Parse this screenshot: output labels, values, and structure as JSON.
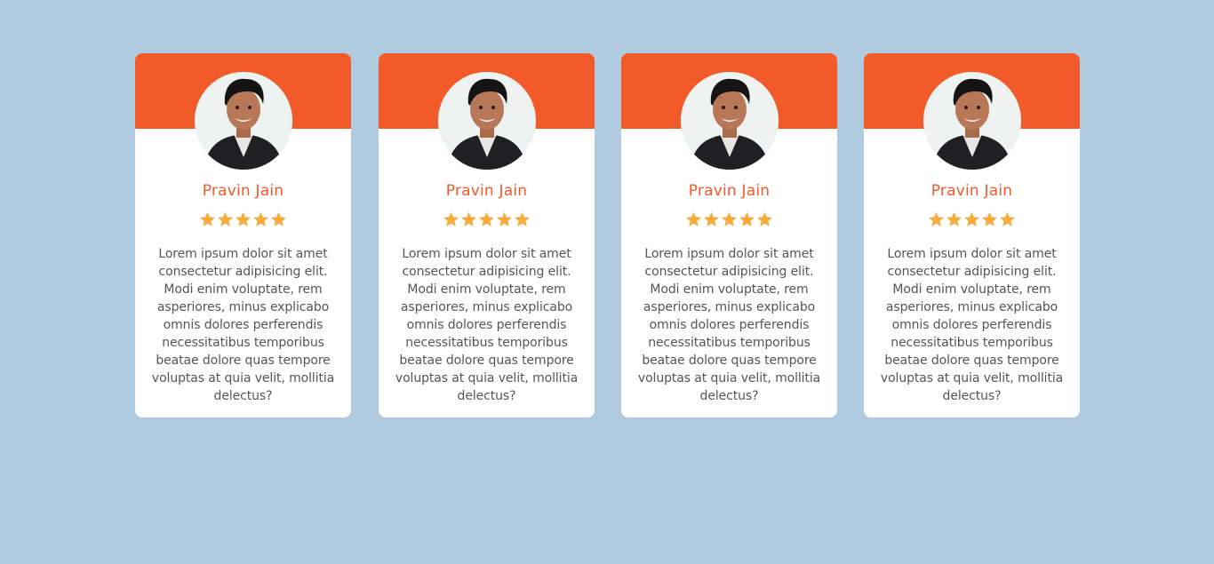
{
  "colors": {
    "page_background": "#b0cbdf",
    "card_background": "#ffffff",
    "accent": "#f25a29",
    "star": "#f6ac3c",
    "body_text": "#555555"
  },
  "cards": [
    {
      "avatar_icon": "user-photo",
      "name": "Pravin Jain",
      "rating": 5,
      "rating_max": 5,
      "review": "Lorem ipsum dolor sit amet consectetur adipisicing elit. Modi enim voluptate, rem asperiores, minus explicabo omnis dolores perferendis necessitatibus temporibus beatae dolore quas tempore voluptas at quia velit, mollitia delectus?"
    },
    {
      "avatar_icon": "user-photo",
      "name": "Pravin Jain",
      "rating": 5,
      "rating_max": 5,
      "review": "Lorem ipsum dolor sit amet consectetur adipisicing elit. Modi enim voluptate, rem asperiores, minus explicabo omnis dolores perferendis necessitatibus temporibus beatae dolore quas tempore voluptas at quia velit, mollitia delectus?"
    },
    {
      "avatar_icon": "user-photo",
      "name": "Pravin Jain",
      "rating": 5,
      "rating_max": 5,
      "review": "Lorem ipsum dolor sit amet consectetur adipisicing elit. Modi enim voluptate, rem asperiores, minus explicabo omnis dolores perferendis necessitatibus temporibus beatae dolore quas tempore voluptas at quia velit, mollitia delectus?"
    },
    {
      "avatar_icon": "user-photo",
      "name": "Pravin Jain",
      "rating": 5,
      "rating_max": 5,
      "review": "Lorem ipsum dolor sit amet consectetur adipisicing elit. Modi enim voluptate, rem asperiores, minus explicabo omnis dolores perferendis necessitatibus temporibus beatae dolore quas tempore voluptas at quia velit, mollitia delectus?"
    }
  ]
}
